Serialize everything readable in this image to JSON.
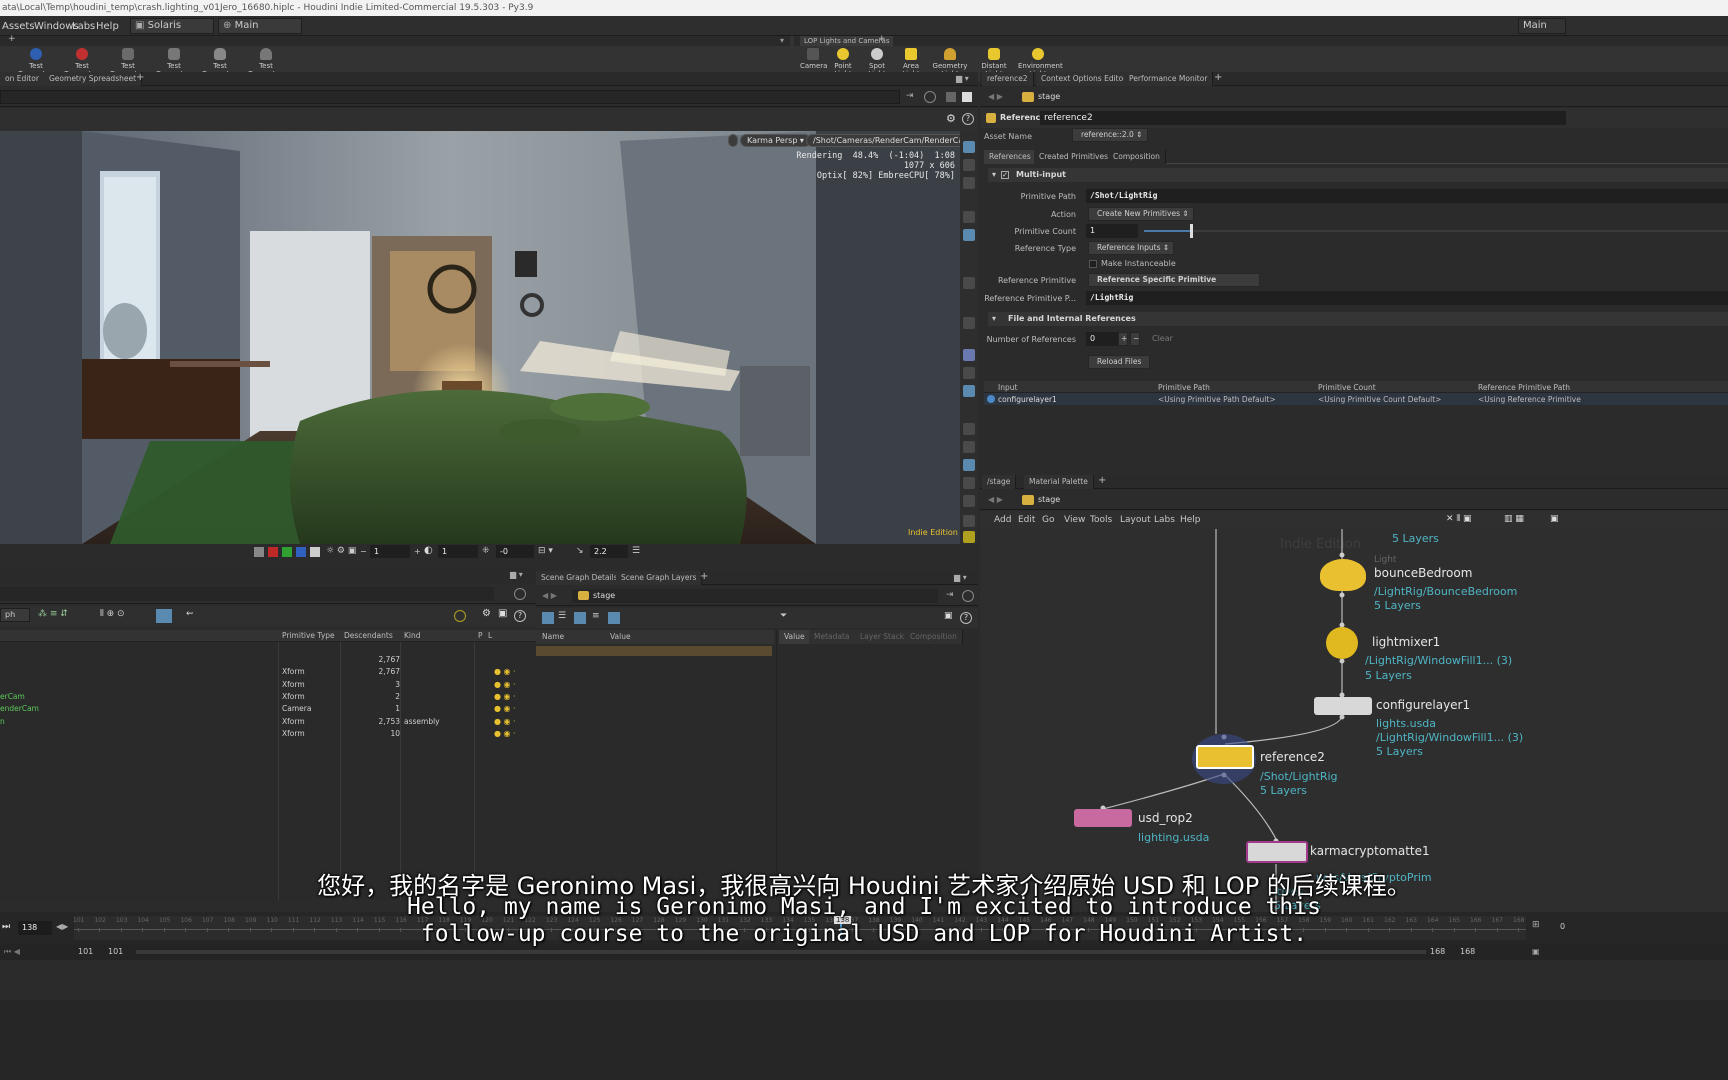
{
  "title_bar": {
    "text": "ata\\Local\\Temp\\houdini_temp\\crash.lighting_v01Jero_16680.hiplc - Houdini Indie Limited-Commercial 19.5.303 - Py3.9"
  },
  "menubar": {
    "items": [
      "Assets",
      "Windows",
      "Labs",
      "Help"
    ],
    "desktop": "Solaris",
    "network": "Main",
    "right": "Main"
  },
  "shelf_left": {
    "tools": [
      "Test Geometry: R...",
      "Test Geometry: S...",
      "Test Geometry: S...",
      "Test Geometry: T...",
      "Test Geometry: T...",
      "Test Geometry: T..."
    ]
  },
  "shelf_right": {
    "tab": "LOP Lights and Cameras",
    "tools": [
      "Camera",
      "Point Light",
      "Spot Light",
      "Area Light",
      "Geometry Light",
      "Distant Light",
      "Environment Light"
    ]
  },
  "left_tabs": [
    "on Editor",
    "Geometry Spreadsheet"
  ],
  "viewport": {
    "camera_menu": "Karma Persp",
    "camera_path": "/Shot/Cameras/RenderCam/RenderCam",
    "hud_line1": "Rendering  48.4%  (-1:04)  1:08",
    "hud_line2": "1077 x 606",
    "hud_line3": "Optix[ 82%] EmbreeCPU[ 78%]",
    "watermark": "Indie Edition",
    "toolbar": {
      "field1": "1",
      "field2": "1",
      "field3": "-0",
      "field4": "2.2"
    }
  },
  "right_tabs": [
    "reference2",
    "Context Options Editor",
    "Performance Monitor"
  ],
  "params": {
    "path": "stage",
    "node_type": "Reference",
    "node_name": "reference2",
    "asset_label": "Asset Name",
    "asset_value": "reference::2.0",
    "tabs": [
      "References",
      "Created Primitives",
      "Composition"
    ],
    "multi_input": "Multi-input",
    "primitive_path_label": "Primitive Path",
    "primitive_path": "/Shot/LightRig",
    "action_label": "Action",
    "action": "Create New Primitives",
    "primitive_count_label": "Primitive Count",
    "primitive_count": "1",
    "reference_type_label": "Reference Type",
    "reference_type": "Reference Inputs",
    "make_instanceable": "Make Instanceable",
    "reference_primitive_label": "Reference Primitive",
    "reference_primitive": "Reference Specific Primitive",
    "reference_primitive_path_label": "Reference Primitive P...",
    "reference_primitive_path": "/LightRig",
    "file_section": "File and Internal References",
    "num_refs_label": "Number of References",
    "num_refs": "0",
    "clear": "Clear",
    "reload": "Reload Files",
    "table_headers": [
      "Input",
      "Primitive Path",
      "Primitive Count",
      "Reference Primitive Path"
    ],
    "table_row": [
      "configurelayer1",
      "<Using Primitive Path Default>",
      "<Using Primitive Count Default>",
      "<Using Reference Primitive"
    ]
  },
  "network": {
    "tabs": [
      "/stage",
      "Material Palette"
    ],
    "path": "stage",
    "menu": [
      "Add",
      "Edit",
      "Go",
      "View",
      "Tools",
      "Layout",
      "Labs",
      "Help"
    ],
    "watermark": "Indie Edition",
    "top_layers": "5 Layers",
    "nodes": {
      "bounce": {
        "type": "Light",
        "name": "bounceBedroom",
        "path": "/LightRig/BounceBedroom",
        "layers": "5 Layers"
      },
      "mixer": {
        "name": "lightmixer1",
        "path": "/LightRig/WindowFill1... (3)",
        "layers": "5 Layers"
      },
      "configure": {
        "name": "configurelayer1",
        "file": "lights.usda",
        "path": "/LightRig/WindowFill1... (3)",
        "layers": "5 Layers"
      },
      "reference": {
        "name": "reference2",
        "path": "/Shot/LightRig",
        "layers": "5 Layers"
      },
      "rop": {
        "name": "usd_rop2",
        "file": "lighting.usda"
      },
      "crypto": {
        "name": "karmacryptomatte1",
        "path": "ucts/Vars/CryptoPrim",
        "extra": "itives",
        "layers": "5 Layers"
      }
    }
  },
  "scene_graph": {
    "headers": [
      "Primitive Type",
      "Descendants",
      "Kind",
      "P",
      "L"
    ],
    "rows": [
      {
        "name": "",
        "type": "",
        "desc": "2,767",
        "kind": ""
      },
      {
        "name": "",
        "type": "Xform",
        "desc": "2,767",
        "kind": ""
      },
      {
        "name": "",
        "type": "Xform",
        "desc": "3",
        "kind": ""
      },
      {
        "name": "erCam",
        "type": "Xform",
        "desc": "2",
        "kind": ""
      },
      {
        "name": "enderCam",
        "type": "Camera",
        "desc": "1",
        "kind": ""
      },
      {
        "name": "n",
        "type": "Xform",
        "desc": "2,753",
        "kind": "assembly"
      },
      {
        "name": "",
        "type": "Xform",
        "desc": "10",
        "kind": ""
      }
    ],
    "left_dropdown": "ph"
  },
  "details": {
    "tabs": [
      "Scene Graph Details",
      "Scene Graph Layers"
    ],
    "path": "stage",
    "headers": [
      "Name",
      "Value"
    ],
    "right_tabs": [
      "Value",
      "Metadata",
      "Layer Stack",
      "Composition"
    ]
  },
  "timeline": {
    "frame": "138",
    "start": "101",
    "start2": "101",
    "end": "168",
    "end2": "168",
    "ticks": [
      "101",
      "102",
      "103",
      "104",
      "105",
      "106",
      "107",
      "108",
      "109",
      "110",
      "111",
      "112",
      "113",
      "114",
      "115",
      "116",
      "117",
      "118",
      "119",
      "120",
      "121",
      "122",
      "123",
      "124",
      "125",
      "126",
      "127",
      "128",
      "129",
      "130",
      "131",
      "132",
      "133",
      "134",
      "135",
      "136",
      "137",
      "138",
      "139",
      "140",
      "141",
      "142",
      "143",
      "144",
      "145",
      "146",
      "147",
      "148",
      "149",
      "150",
      "151",
      "152",
      "153",
      "154",
      "155",
      "156",
      "157",
      "158",
      "159",
      "160",
      "161",
      "162",
      "163",
      "164",
      "165",
      "166",
      "167",
      "168"
    ],
    "marker": "138"
  },
  "subtitles": {
    "chinese": "您好，我的名字是 Geronimo Masi，我很高兴向 Houdini 艺术家介绍原始 USD 和 LOP 的后续课程。",
    "english1": "Hello, my name is Geronimo Masi, and I'm excited to introduce this",
    "english2": "follow-up course to the original USD and LOP for Houdini Artist."
  }
}
